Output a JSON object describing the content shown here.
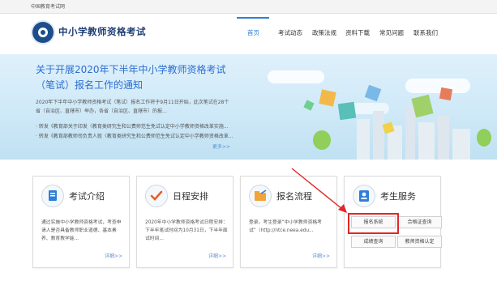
{
  "topbar": {
    "text": "中国教育考试网"
  },
  "header": {
    "site_title": "中小学教师资格考试"
  },
  "nav": {
    "items": [
      {
        "label": "首页",
        "active": true
      },
      {
        "label": "考试动态"
      },
      {
        "label": "政策法规"
      },
      {
        "label": "资料下载"
      },
      {
        "label": "常见问题"
      },
      {
        "label": "联系我们"
      }
    ]
  },
  "banner": {
    "title": "关于开展2020年下半年中小学教师资格考试（笔试）报名工作的通知",
    "summary": "2020年下半年中小学教师资格考试（笔试）报名工作将于9月11日开始，此次笔试在28个省（自治区、直辖市）举办，各省（自治区、直辖市）的报...",
    "bullets": [
      "· 转发《教育部关于印发〈教育类研究生和公费师范生免试认定中小学教师资格改革实施...",
      "· 转发《教育部教师司负责人就〈教育类研究生和公费师范生免试认定中小学教师资格改革..."
    ],
    "more": "更多>>"
  },
  "cards": [
    {
      "title": "考试介绍",
      "text": "通过实施中小学教师资格考试，考查申请人是否具备教师职业道德、基本素养、教育教学能...",
      "more": "详细>>",
      "icon": "clipboard-pen-icon"
    },
    {
      "title": "日程安排",
      "text": "2020年中小学教师资格考试日程安排：下半年笔试时间为10月31日，下半年面试时间...",
      "more": "详细>>",
      "icon": "checkmark-icon"
    },
    {
      "title": "报名流程",
      "text": "登录。考生登录“中小学教师资格考试”（http://ntce.neea.edu...",
      "more": "详细>>",
      "icon": "folder-pen-icon"
    },
    {
      "title": "考生服务",
      "icon": "person-card-icon",
      "buttons": [
        "报名系统",
        "合格证查询",
        "成绩查询",
        "教师资格认定"
      ]
    }
  ],
  "colors": {
    "accent": "#2f7fd8",
    "brand": "#1f3f74",
    "highlight": "#e02828"
  }
}
